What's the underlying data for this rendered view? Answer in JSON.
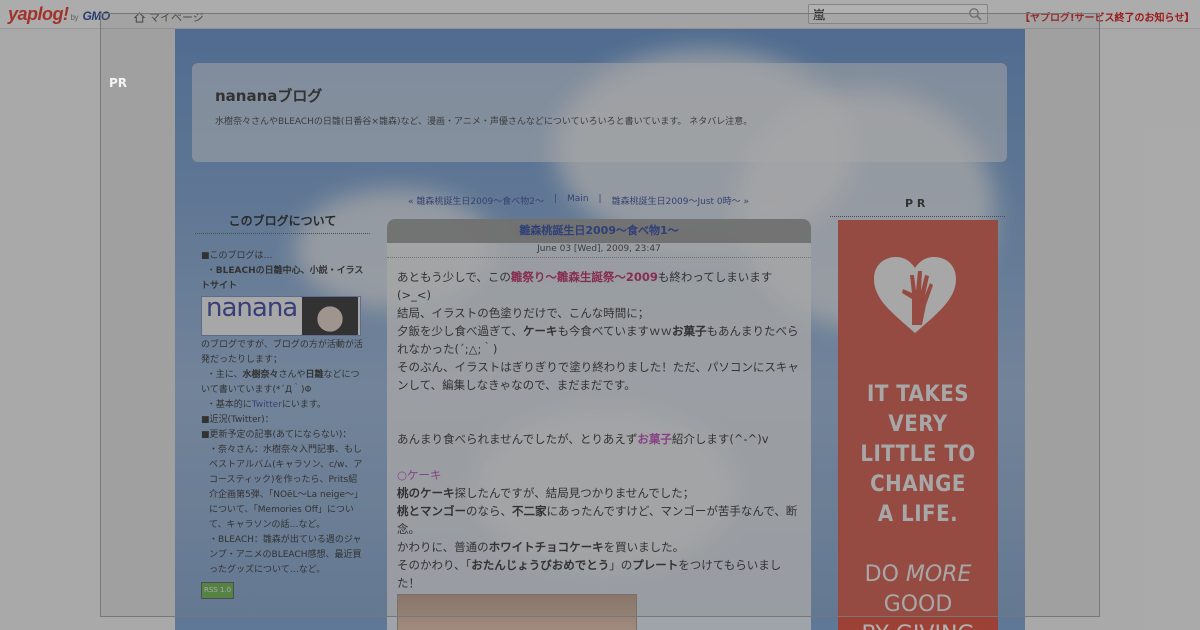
{
  "topbar": {
    "logo_main": "yaplog!",
    "logo_by": "by",
    "logo_gmo": "GMO",
    "home_icon": "home-icon",
    "home_label": "マイページ",
    "search_value": "嵐",
    "notice": "【ヤプログ!サービス終了のお知らせ】"
  },
  "blog": {
    "title": "nananaブログ",
    "description": "水樹奈々さんやBLEACHの日雛(日番谷×雛森)など、漫画・アニメ・声優さんなどについていろいろと書いています。 ネタバレ注意。"
  },
  "nav": {
    "prev": "« 雛森桃誕生日2009～食べ物2～",
    "main": "Main",
    "next": "雛森桃誕生日2009～Just 0時～ »"
  },
  "sidebar": {
    "title": "このブログについて",
    "line1": "■このブログは…",
    "line2_pre": "・",
    "line2_b": "BLEACHの日雛中心、小説・イラストサイト",
    "banner_text": "nanana",
    "line3": "のブログですが、ブログの方が活動が活発だったりします；",
    "line4_pre": "・主に、",
    "line4_b1": "水樹奈々",
    "line4_mid": "さんや",
    "line4_b2": "日雛",
    "line4_post": "などについて書いています(*´Д｀)Φ",
    "line5_pre": "・基本的に",
    "line5_link": "Twitter",
    "line5_post": "にいます。",
    "line6": "■近況(Twitter)：",
    "line7": "■更新予定の記事(あてにならない)：",
    "line8": "・奈々さん：水樹奈々入門記事、もしベストアルバム(キャラソン、c/w、アコースティック)を作ったら、Prits紹介企画第5弾、「NOëL～La neige～」について、「Memories Off」について、キャラソンの話…など。",
    "line9": "・BLEACH：雛森が出ている週のジャンプ・アニメのBLEACH感想、最近買ったグッズについて…など。",
    "rss": "RSS 1.0"
  },
  "post": {
    "title": "雛森桃誕生日2009～食べ物1～",
    "date": "June 03 [Wed], 2009, 23:47",
    "p1_pre": "あともう少しで、この",
    "p1_hl": "雛祭り～雛森生誕祭～2009",
    "p1_post": "も終わってしまいます(>_<)",
    "p2": "結局、イラストの色塗りだけで、こんな時間に；",
    "p3_pre": "夕飯を少し食べ過ぎて、",
    "p3_b1": "ケーキ",
    "p3_mid": "も今食べていますｗｗ",
    "p3_b2": "お菓子",
    "p3_post": "もあんまりたべられなかった(´;△;｀)",
    "p4": "そのぶん、イラストはぎりぎりで塗り終わりました！ただ、パソコンにスキャンして、編集しなきゃなので、まだまだです。",
    "p5_pre": "あんまり食べられませんでしたが、とりあえず",
    "p5_pink": "お菓子",
    "p5_post": "紹介します(^-^)v",
    "p6": "○ケーキ",
    "p7_b": "桃のケーキ",
    "p7_post": "探したんですが、結局見つかりませんでした；",
    "p8_b1": "桃とマンゴー",
    "p8_mid": "のなら、",
    "p8_b2": "不二家",
    "p8_post": "にあったんですけど、マンゴーが苦手なんで、断念。",
    "p9_pre": "かわりに、普通の",
    "p9_b": "ホワイトチョコケーキ",
    "p9_post": "を買いました。",
    "p10_pre": "そのかわり、「",
    "p10_b1": "おたんじょうびおめでとう",
    "p10_mid": "」の",
    "p10_b2": "プレート",
    "p10_post": "をつけてもらいました！"
  },
  "right": {
    "pr": "P R",
    "ad_line1": "IT TAKES",
    "ad_line2": "VERY",
    "ad_line3": "LITTLE TO",
    "ad_line4": "CHANGE",
    "ad_line5": "A LIFE.",
    "ad_line6a": "DO ",
    "ad_line6b": "MORE",
    "ad_line7": "GOOD",
    "ad_line8": "BY GIVING"
  },
  "overlay": {
    "pr": "PR",
    "close_icon": "close-icon"
  }
}
